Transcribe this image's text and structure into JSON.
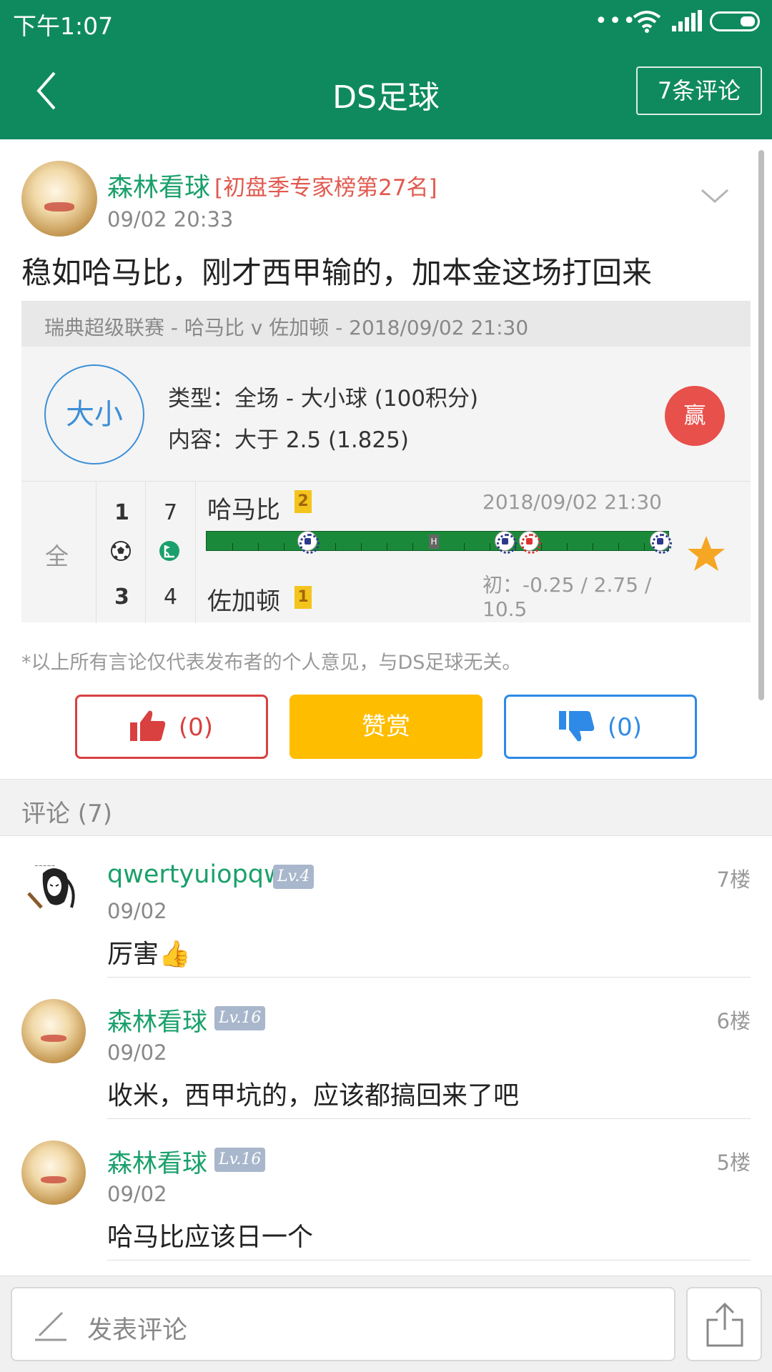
{
  "status_bar": {
    "time": "下午1:07"
  },
  "app_bar": {
    "title": "DS足球",
    "comments_button": "7条评论"
  },
  "post": {
    "author": "森林看球",
    "rank": "[初盘季专家榜第27名]",
    "time": "09/02 20:33",
    "text": "稳如哈马比，刚才西甲输的，加本金这场打回来",
    "match_line": "瑞典超级联赛 - 哈马比 v 佐加顿 - 2018/09/02 21:30",
    "bet_category": "大小",
    "bet_type": "类型：全场 - 大小球 (100积分)",
    "bet_content": "内容：大于 2.5 (1.825)",
    "result": "赢"
  },
  "match": {
    "period": "全",
    "home_score": "1",
    "home_corners": "7",
    "away_score": "3",
    "away_corners": "4",
    "home_team": "哈马比",
    "home_rank": "2",
    "away_team": "佐加顿",
    "away_rank": "1",
    "date": "2018/09/02 21:30",
    "odds": "初：-0.25 / 2.75 / 10.5",
    "ht_marker": "H"
  },
  "disclaimer": "*以上所有言论仅代表发布者的个人意见，与DS足球无关。",
  "actions": {
    "like": "(0)",
    "reward": "赞赏",
    "dislike": "(0)"
  },
  "comments_header": "评论 (7)",
  "comments": [
    {
      "name": "qwertyuiopqw",
      "level": "Lv.4",
      "floor": "7楼",
      "date": "09/02",
      "text": "厉害👍"
    },
    {
      "name": "森林看球",
      "level": "Lv.16",
      "floor": "6楼",
      "date": "09/02",
      "text": "收米，西甲坑的，应该都搞回来了吧"
    },
    {
      "name": "森林看球",
      "level": "Lv.16",
      "floor": "5楼",
      "date": "09/02",
      "text": "哈马比应该日一个"
    }
  ],
  "bottom_bar": {
    "placeholder": "发表评论"
  },
  "colors": {
    "brand_green": "#0f8a5f",
    "name_green": "#1aa06b",
    "like_red": "#d94040",
    "reward_yellow": "#ffbd00",
    "dislike_blue": "#2e8ae6"
  }
}
